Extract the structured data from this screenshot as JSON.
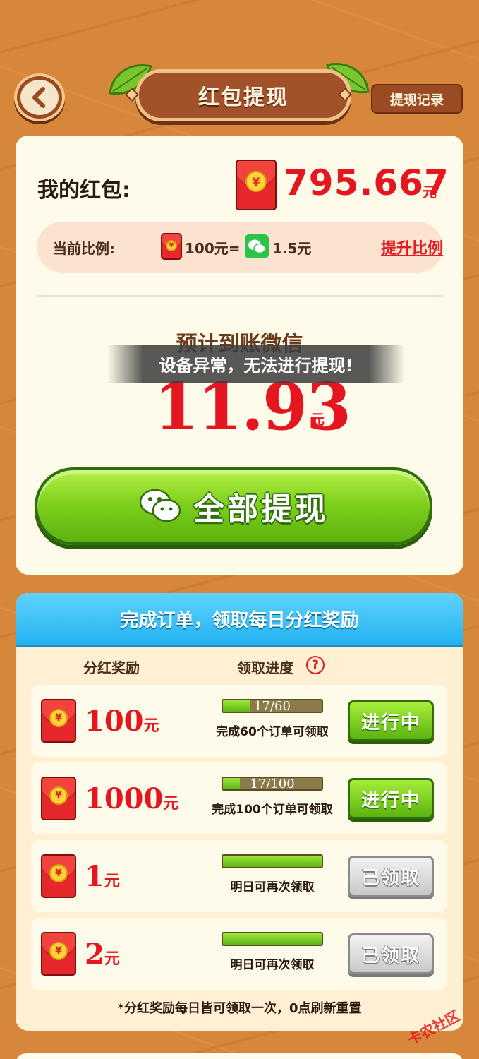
{
  "header": {
    "title": "红包提现",
    "record_label": "提现记录"
  },
  "wallet": {
    "my_label": "我的红包:",
    "amount": "795.667",
    "unit": "元",
    "ratio_label": "当前比例:",
    "ratio_from": "100元=",
    "ratio_to": "1.5元",
    "upgrade_label": "提升比例"
  },
  "estimate": {
    "label": "预计到账微信",
    "warning": "设备异常，无法进行提现!",
    "amount": "11.93",
    "unit": "元",
    "withdraw_all_label": "全部提现"
  },
  "dividend": {
    "title": "完成订单，领取每日分红奖励",
    "col_reward": "分红奖励",
    "col_progress": "领取进度",
    "help_icon": "?",
    "rows": [
      {
        "amount": "100",
        "unit": "元",
        "progress_text": "17/60",
        "progress": 0.28,
        "note": "完成60个订单可领取",
        "button": "进行中",
        "state": "active"
      },
      {
        "amount": "1000",
        "unit": "元",
        "progress_text": "17/100",
        "progress": 0.17,
        "note": "完成100个订单可领取",
        "button": "进行中",
        "state": "active"
      },
      {
        "amount": "1",
        "unit": "元",
        "progress_text": "",
        "progress": 1.0,
        "note": "明日可再次领取",
        "button": "已领取",
        "state": "claimed"
      },
      {
        "amount": "2",
        "unit": "元",
        "progress_text": "",
        "progress": 1.0,
        "note": "明日可再次领取",
        "button": "已领取",
        "state": "claimed"
      }
    ],
    "footnote": "*分红奖励每日皆可领取一次，0点刷新重置"
  },
  "watermark": "卡农社区",
  "colors": {
    "background": "#d7873b",
    "accent_red": "#e5161f",
    "button_green": "#5cb20f",
    "header_blue": "#22b2ef"
  }
}
